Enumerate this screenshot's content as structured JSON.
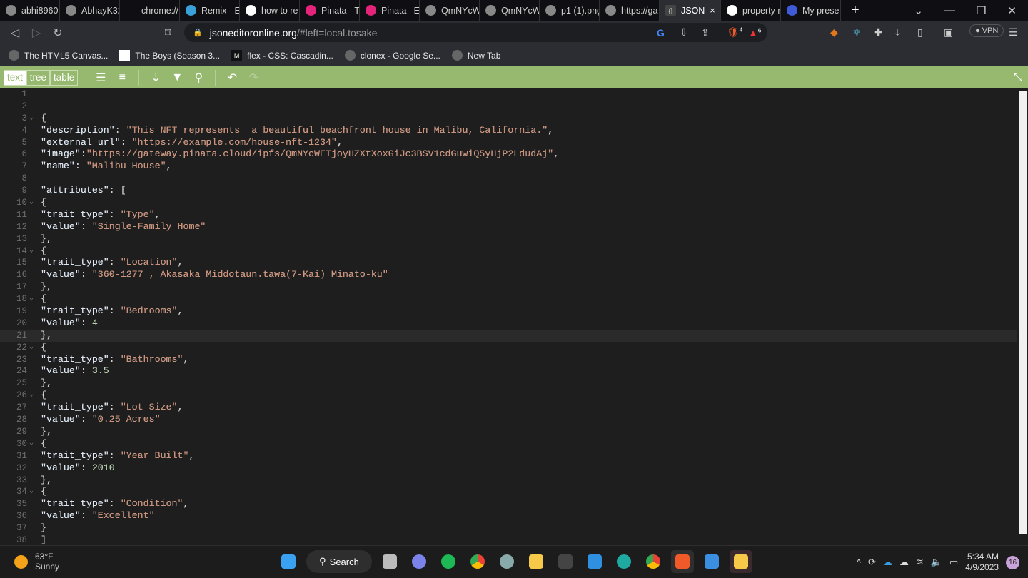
{
  "browser": {
    "tabs": [
      {
        "label": "abhi8960c",
        "icon": "github-icon"
      },
      {
        "label": "AbhayK32",
        "icon": "github-icon"
      },
      {
        "label": "chrome://newt",
        "icon": "none"
      },
      {
        "label": "Remix - Et",
        "icon": "remix-icon"
      },
      {
        "label": "how to re",
        "icon": "google-icon"
      },
      {
        "label": "Pinata - Th",
        "icon": "pinata-icon"
      },
      {
        "label": "Pinata | Et",
        "icon": "pinata-icon"
      },
      {
        "label": "QmNYcW",
        "icon": "globe-icon"
      },
      {
        "label": "QmNYcW",
        "icon": "globe-icon"
      },
      {
        "label": "p1 (1).png",
        "icon": "globe-icon"
      },
      {
        "label": "https://ga",
        "icon": "globe-icon"
      },
      {
        "label": "JSON",
        "icon": "json-icon",
        "active": true
      },
      {
        "label": "property r",
        "icon": "google-icon"
      },
      {
        "label": "My preser",
        "icon": "circle-icon"
      }
    ],
    "url_host": "jsoneditoronline.org",
    "url_rest": "/#left=local.tosake",
    "vpn_label": "VPN",
    "brave_badge": "4",
    "rewards_badge": "6",
    "bookmarks": [
      {
        "label": "The HTML5 Canvas...",
        "icon": "globe-icon"
      },
      {
        "label": "The Boys (Season 3...",
        "icon": "page-icon"
      },
      {
        "label": "flex - CSS: Cascadin...",
        "icon": "mdn-icon"
      },
      {
        "label": "clonex - Google Se...",
        "icon": "globe-icon"
      },
      {
        "label": "New Tab",
        "icon": "globe-icon"
      }
    ]
  },
  "editor": {
    "modes": [
      "text",
      "tree",
      "table"
    ],
    "active_mode": "text",
    "accent": "#97b96f",
    "current_line": 21,
    "lines": [
      "",
      "",
      "{",
      "\"description\": \"This NFT represents  a beautiful beachfront house in Malibu, California.\",",
      "\"external_url\": \"https://example.com/house-nft-1234\",",
      "\"image\":\"https://gateway.pinata.cloud/ipfs/QmNYcWETjoyHZXtXoxGiJc3BSV1cdGuwiQ5yHjP2LdudAj\",",
      "\"name\": \"Malibu House\",",
      "",
      "\"attributes\": [",
      "{",
      "\"trait_type\": \"Type\",",
      "\"value\": \"Single-Family Home\"",
      "},",
      "{",
      "\"trait_type\": \"Location\",",
      "\"value\": \"360-1277 , Akasaka Middotaun.tawa(7-Kai) Minato-ku\"",
      "},",
      "{",
      "\"trait_type\": \"Bedrooms\",",
      "\"value\": 4",
      "},",
      "{",
      "\"trait_type\": \"Bathrooms\",",
      "\"value\": 3.5",
      "},",
      "{",
      "\"trait_type\": \"Lot Size\",",
      "\"value\": \"0.25 Acres\"",
      "},",
      "{",
      "\"trait_type\": \"Year Built\",",
      "\"value\": 2010",
      "},",
      "{",
      "\"trait_type\": \"Condition\",",
      "\"value\": \"Excellent\"",
      "}",
      "]"
    ],
    "fold_lines": [
      3,
      10,
      14,
      18,
      22,
      26,
      30,
      34
    ]
  },
  "taskbar": {
    "temp": "63°F",
    "weather": "Sunny",
    "search_label": "Search",
    "time": "5:34 AM",
    "date": "4/9/2023",
    "notifications": "16"
  }
}
